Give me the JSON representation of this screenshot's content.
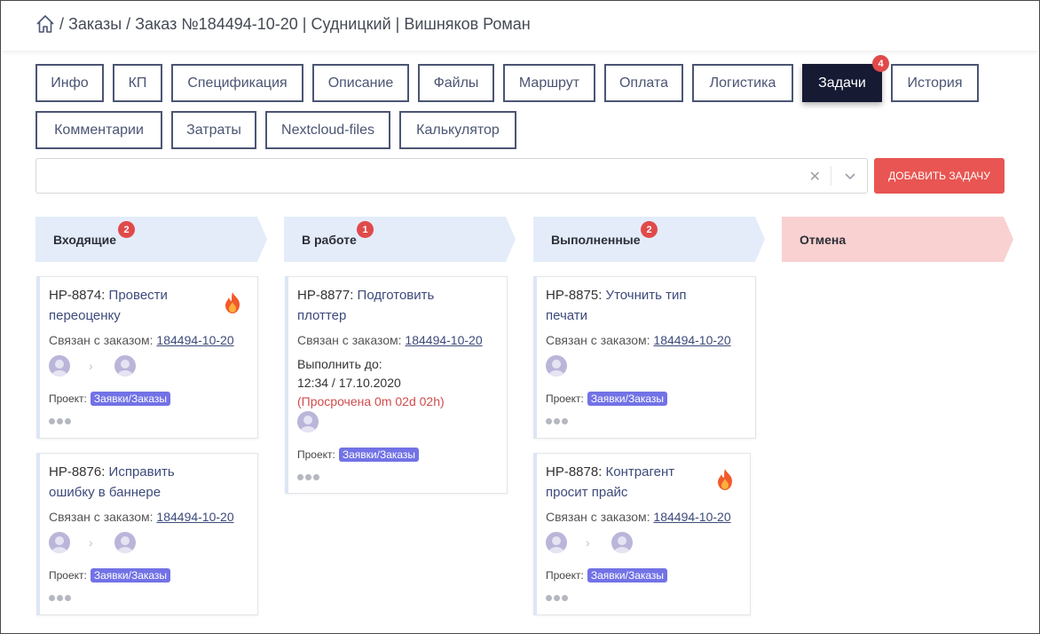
{
  "breadcrumb": {
    "home_icon": "home-icon",
    "text": "/ Заказы / Заказ №184494-10-20 | Судницкий | Вишняков Роман"
  },
  "tabs": [
    {
      "label": "Инфо"
    },
    {
      "label": "КП"
    },
    {
      "label": "Спецификация"
    },
    {
      "label": "Описание"
    },
    {
      "label": "Файлы"
    },
    {
      "label": "Маршрут"
    },
    {
      "label": "Оплата"
    },
    {
      "label": "Логистика"
    },
    {
      "label": "Задачи",
      "active": true,
      "badge": "4"
    },
    {
      "label": "История"
    },
    {
      "label": "Комментарии"
    },
    {
      "label": "Затраты"
    },
    {
      "label": "Nextcloud-files"
    },
    {
      "label": "Калькулятор"
    }
  ],
  "search": {
    "value": "",
    "clear_icon": "close-icon",
    "toggle_icon": "chevron-down-icon"
  },
  "add_task_label": "ДОБАВИТЬ ЗАДАЧУ",
  "colors": {
    "accent": "#161a33",
    "danger": "#e85552",
    "tag": "#7272e6",
    "badge": "#e04a4a",
    "column": "#e4ecfa",
    "cancel_column": "#f9d1d1"
  },
  "columns": [
    {
      "title": "Входящие",
      "badge": "2"
    },
    {
      "title": "В работе",
      "badge": "1"
    },
    {
      "title": "Выполненные",
      "badge": "2"
    },
    {
      "title": "Отмена"
    }
  ],
  "labels": {
    "linked": "Связан с заказом:",
    "project": "Проект:",
    "due": "Выполнить до:"
  },
  "cards": [
    {
      "id": "НР-8874:",
      "title": "Провести переоценку",
      "order": "184494-10-20",
      "project": "Заявки/Заказы",
      "urgent": true
    },
    {
      "id": "НР-8876:",
      "title": "Исправить ошибку в баннере",
      "order": "184494-10-20",
      "project": "Заявки/Заказы"
    },
    {
      "id": "НР-8877:",
      "title": "Подготовить плоттер",
      "order": "184494-10-20",
      "project": "Заявки/Заказы",
      "due": "12:34 / 17.10.2020",
      "overdue": "(Просрочена 0m 02d 02h)"
    },
    {
      "id": "НР-8875:",
      "title": "Уточнить тип печати",
      "order": "184494-10-20",
      "project": "Заявки/Заказы"
    },
    {
      "id": "НР-8878:",
      "title": "Контрагент просит прайс",
      "order": "184494-10-20",
      "project": "Заявки/Заказы",
      "urgent": true
    }
  ]
}
